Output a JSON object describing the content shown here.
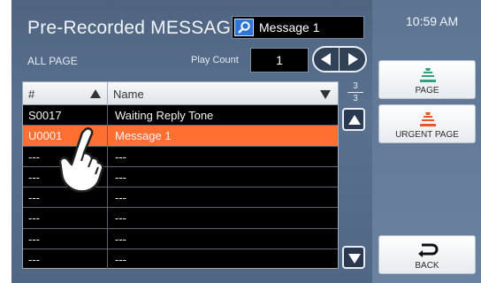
{
  "header": {
    "title": "Pre-Recorded MESSAGES",
    "search_value": "Message 1",
    "clock": "10:59 AM"
  },
  "controls": {
    "all_page_label": "ALL PAGE",
    "play_count_label": "Play Count",
    "play_count_value": "1"
  },
  "table": {
    "col_num": "#",
    "col_name": "Name",
    "rows": [
      {
        "num": "S0017",
        "name": "Waiting Reply Tone",
        "selected": false
      },
      {
        "num": "U0001",
        "name": "Message 1",
        "selected": true
      },
      {
        "num": "---",
        "name": "---",
        "selected": false
      },
      {
        "num": "---",
        "name": "---",
        "selected": false
      },
      {
        "num": "---",
        "name": "---",
        "selected": false
      },
      {
        "num": "---",
        "name": "---",
        "selected": false
      },
      {
        "num": "---",
        "name": "---",
        "selected": false
      },
      {
        "num": "---",
        "name": "---",
        "selected": false
      }
    ]
  },
  "pager": {
    "current": "3",
    "total": "3"
  },
  "side_buttons": {
    "page": "PAGE",
    "urgent_page": "URGENT PAGE",
    "back": "BACK"
  },
  "colors": {
    "selected_row": "#ff6f32",
    "page_icon": "#2fa37a",
    "urgent_icon": "#e8562a"
  }
}
